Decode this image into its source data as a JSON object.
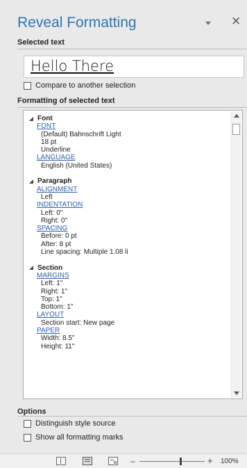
{
  "pane": {
    "title": "Reveal Formatting"
  },
  "selected": {
    "heading": "Selected text",
    "sample": "Hello There",
    "compare_label": "Compare to another selection"
  },
  "formatting": {
    "heading": "Formatting of selected text",
    "groups": [
      {
        "title": "Font",
        "categories": [
          {
            "label": "FONT",
            "values": [
              "(Default) Bahnschrift Light",
              "18 pt",
              "Underline"
            ]
          },
          {
            "label": "LANGUAGE",
            "values": [
              "English (United States)"
            ]
          }
        ]
      },
      {
        "title": "Paragraph",
        "categories": [
          {
            "label": "ALIGNMENT",
            "values": [
              "Left"
            ]
          },
          {
            "label": "INDENTATION",
            "values": [
              "Left:  0\"",
              "Right:  0\""
            ]
          },
          {
            "label": "SPACING",
            "values": [
              "Before:  0 pt",
              "After:  8 pt",
              "Line spacing:  Multiple 1.08 li"
            ]
          }
        ]
      },
      {
        "title": "Section",
        "categories": [
          {
            "label": "MARGINS",
            "values": [
              "Left:  1\"",
              "Right:  1\"",
              "Top:  1\"",
              "Bottom:  1\""
            ]
          },
          {
            "label": "LAYOUT",
            "values": [
              "Section start: New page"
            ]
          },
          {
            "label": "PAPER",
            "values": [
              "Width:  8.5\"",
              "Height:  11\""
            ]
          }
        ]
      }
    ]
  },
  "options": {
    "heading": "Options",
    "distinguish_label": "Distinguish style source",
    "show_marks_label": "Show all formatting marks"
  },
  "status": {
    "zoom_minus": "–",
    "zoom_plus": "+",
    "zoom_level": "100%"
  }
}
